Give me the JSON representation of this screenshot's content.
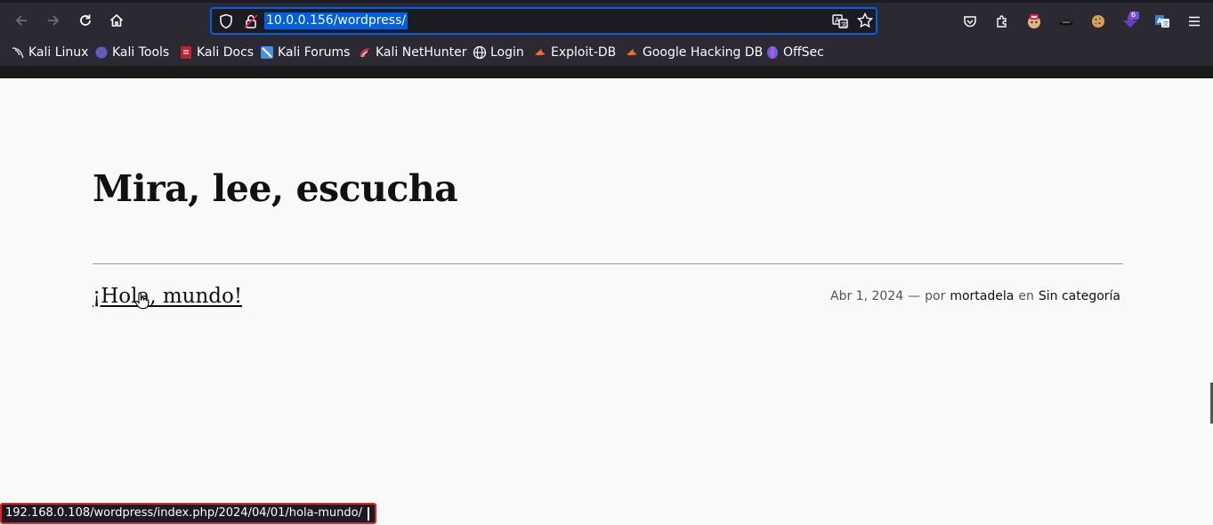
{
  "browser": {
    "url": "10.0.0.156/wordpress/",
    "bookmarks": [
      {
        "label": "Kali Linux",
        "icon": "kali-dragon-icon"
      },
      {
        "label": "Kali Tools",
        "icon": "kali-tools-icon"
      },
      {
        "label": "Kali Docs",
        "icon": "kali-docs-icon"
      },
      {
        "label": "Kali Forums",
        "icon": "kali-forums-icon"
      },
      {
        "label": "Kali NetHunter",
        "icon": "nethunter-icon"
      },
      {
        "label": "Login",
        "icon": "globe-icon"
      },
      {
        "label": "Exploit-DB",
        "icon": "exploit-db-icon"
      },
      {
        "label": "Google Hacking DB",
        "icon": "ghdb-icon"
      },
      {
        "label": "OffSec",
        "icon": "offsec-icon"
      }
    ],
    "extension_badge": "6",
    "status_url": "192.168.0.108/wordpress/index.php/2024/04/01/hola-mundo/"
  },
  "page": {
    "site_title": "Mira, lee, escucha",
    "post": {
      "title": "¡Hola, mundo!",
      "date": "Abr 1, 2024",
      "dash": "—",
      "by_label": "por",
      "author": "mortadela",
      "in_label": "en",
      "category": "Sin categoría"
    }
  },
  "colors": {
    "chrome_bg": "#2b2a33",
    "url_highlight": "#0060df",
    "page_bg": "#f9f9f9",
    "status_border": "#e0242b"
  }
}
